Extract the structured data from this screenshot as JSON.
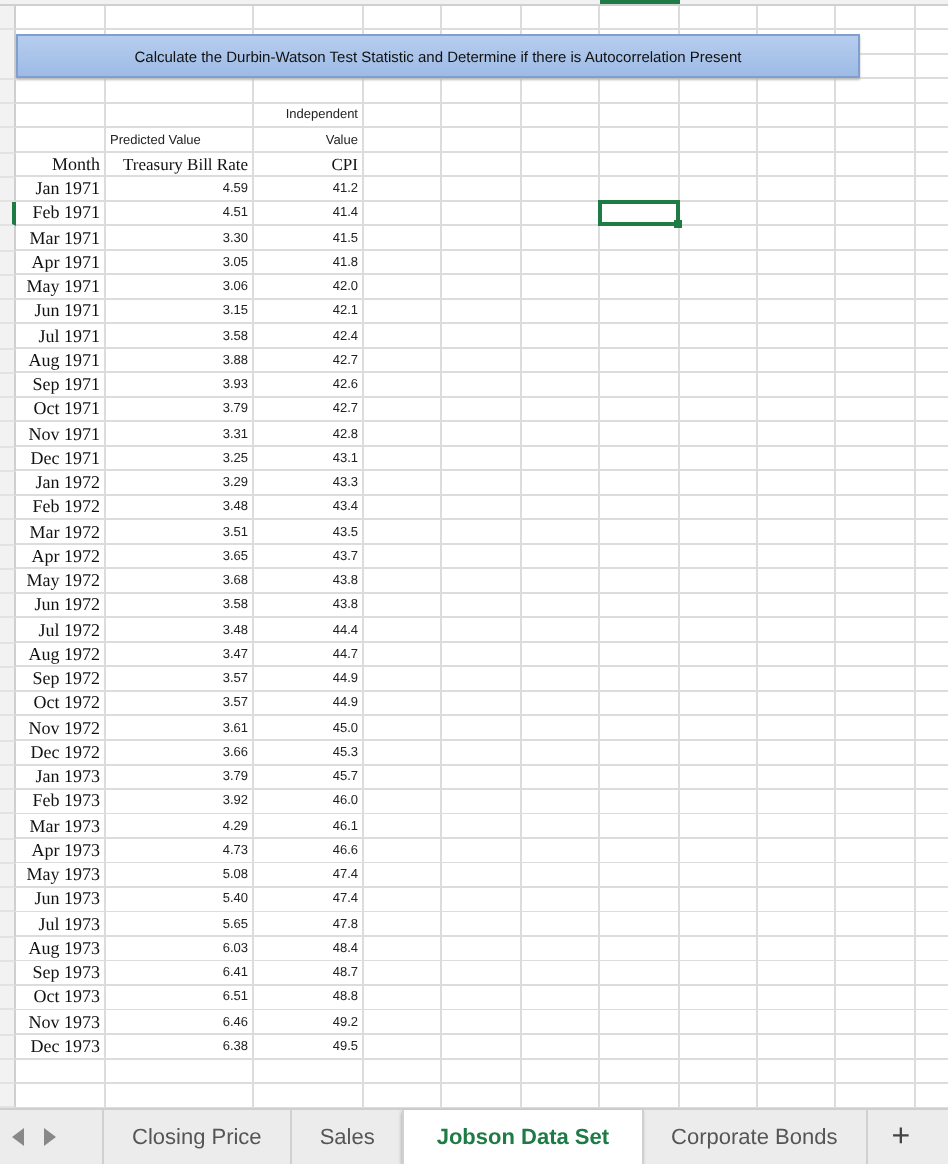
{
  "sheet": {
    "banner": "Calculate the Durbin-Watson Test Statistic and Determine if there is Autocorrelation Present",
    "headers": {
      "month": "Month",
      "rate_caption": "Predicted Value",
      "rate": "Treasury Bill Rate",
      "cpi_caption_1": "Independent",
      "cpi_caption_2": "Value",
      "cpi": "CPI"
    },
    "rows": [
      {
        "month": "Jan 1971",
        "rate": "4.59",
        "cpi": "41.2",
        "selected": false
      },
      {
        "month": "Feb 1971",
        "rate": "4.51",
        "cpi": "41.4",
        "selected": true
      },
      {
        "month": "Mar 1971",
        "rate": "3.30",
        "cpi": "41.5",
        "selected": false
      },
      {
        "month": "Apr 1971",
        "rate": "3.05",
        "cpi": "41.8",
        "selected": false
      },
      {
        "month": "May 1971",
        "rate": "3.06",
        "cpi": "42.0",
        "selected": false
      },
      {
        "month": "Jun 1971",
        "rate": "3.15",
        "cpi": "42.1",
        "selected": false
      },
      {
        "month": "Jul 1971",
        "rate": "3.58",
        "cpi": "42.4",
        "selected": false
      },
      {
        "month": "Aug 1971",
        "rate": "3.88",
        "cpi": "42.7",
        "selected": false
      },
      {
        "month": "Sep 1971",
        "rate": "3.93",
        "cpi": "42.6",
        "selected": false
      },
      {
        "month": "Oct 1971",
        "rate": "3.79",
        "cpi": "42.7",
        "selected": false
      },
      {
        "month": "Nov 1971",
        "rate": "3.31",
        "cpi": "42.8",
        "selected": false
      },
      {
        "month": "Dec 1971",
        "rate": "3.25",
        "cpi": "43.1",
        "selected": false
      },
      {
        "month": "Jan 1972",
        "rate": "3.29",
        "cpi": "43.3",
        "selected": false
      },
      {
        "month": "Feb 1972",
        "rate": "3.48",
        "cpi": "43.4",
        "selected": false
      },
      {
        "month": "Mar 1972",
        "rate": "3.51",
        "cpi": "43.5",
        "selected": false
      },
      {
        "month": "Apr 1972",
        "rate": "3.65",
        "cpi": "43.7",
        "selected": false
      },
      {
        "month": "May 1972",
        "rate": "3.68",
        "cpi": "43.8",
        "selected": false
      },
      {
        "month": "Jun 1972",
        "rate": "3.58",
        "cpi": "43.8",
        "selected": false
      },
      {
        "month": "Jul 1972",
        "rate": "3.48",
        "cpi": "44.4",
        "selected": false
      },
      {
        "month": "Aug 1972",
        "rate": "3.47",
        "cpi": "44.7",
        "selected": false
      },
      {
        "month": "Sep 1972",
        "rate": "3.57",
        "cpi": "44.9",
        "selected": false
      },
      {
        "month": "Oct 1972",
        "rate": "3.57",
        "cpi": "44.9",
        "selected": false
      },
      {
        "month": "Nov 1972",
        "rate": "3.61",
        "cpi": "45.0",
        "selected": false
      },
      {
        "month": "Dec 1972",
        "rate": "3.66",
        "cpi": "45.3",
        "selected": false
      },
      {
        "month": "Jan 1973",
        "rate": "3.79",
        "cpi": "45.7",
        "selected": false
      },
      {
        "month": "Feb 1973",
        "rate": "3.92",
        "cpi": "46.0",
        "selected": false
      },
      {
        "month": "Mar 1973",
        "rate": "4.29",
        "cpi": "46.1",
        "selected": false
      },
      {
        "month": "Apr 1973",
        "rate": "4.73",
        "cpi": "46.6",
        "selected": false
      },
      {
        "month": "May 1973",
        "rate": "5.08",
        "cpi": "47.4",
        "selected": false
      },
      {
        "month": "Jun 1973",
        "rate": "5.40",
        "cpi": "47.4",
        "selected": false
      },
      {
        "month": "Jul 1973",
        "rate": "5.65",
        "cpi": "47.8",
        "selected": false
      },
      {
        "month": "Aug 1973",
        "rate": "6.03",
        "cpi": "48.4",
        "selected": false
      },
      {
        "month": "Sep 1973",
        "rate": "6.41",
        "cpi": "48.7",
        "selected": false
      },
      {
        "month": "Oct 1973",
        "rate": "6.51",
        "cpi": "48.8",
        "selected": false
      },
      {
        "month": "Nov 1973",
        "rate": "6.46",
        "cpi": "49.2",
        "selected": false
      },
      {
        "month": "Dec 1973",
        "rate": "6.38",
        "cpi": "49.5",
        "selected": false
      }
    ]
  },
  "tabs": [
    {
      "label": "Closing Price",
      "selected": false
    },
    {
      "label": "Sales",
      "selected": false
    },
    {
      "label": "Jobson Data Set",
      "selected": true
    },
    {
      "label": "Corporate Bonds",
      "selected": false
    }
  ],
  "add_tab": "+"
}
